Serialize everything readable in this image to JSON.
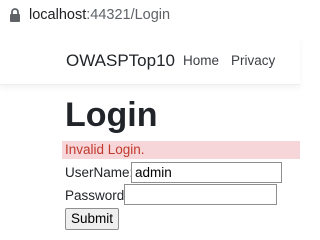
{
  "browser": {
    "url_host": "localhost",
    "url_rest": ":44321/Login",
    "icons": {
      "lock": "lock-icon"
    }
  },
  "navbar": {
    "brand": "OWASPTop10",
    "links": [
      {
        "label": "Home"
      },
      {
        "label": "Privacy"
      }
    ]
  },
  "main": {
    "title": "Login",
    "error": "Invalid Login.",
    "username_label": "UserName:",
    "username_value": "admin",
    "password_label": "Password:",
    "password_value": "",
    "submit_label": "Submit"
  },
  "colors": {
    "error_text": "#c0392b",
    "error_background": "#f6d6d9"
  }
}
